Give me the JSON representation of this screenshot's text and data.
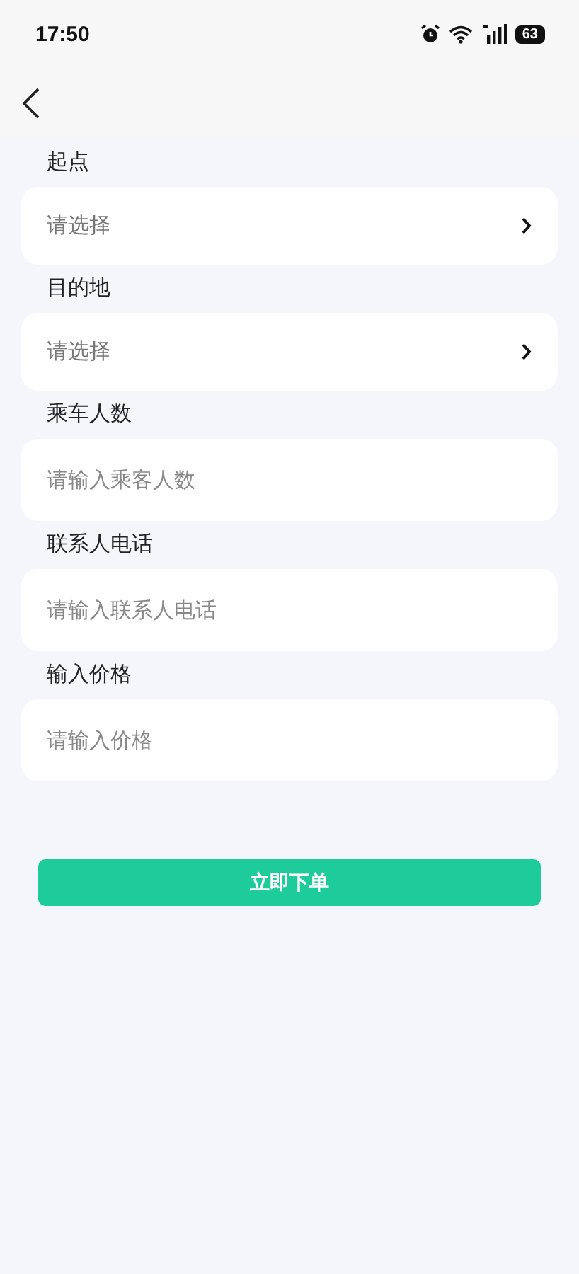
{
  "status_bar": {
    "time": "17:50",
    "battery": "63"
  },
  "fields": [
    {
      "label": "起点",
      "kind": "select",
      "placeholder": "请选择"
    },
    {
      "label": "目的地",
      "kind": "select",
      "placeholder": "请选择"
    },
    {
      "label": "乘车人数",
      "kind": "input",
      "placeholder": "请输入乘客人数"
    },
    {
      "label": "联系人电话",
      "kind": "input",
      "placeholder": "请输入联系人电话"
    },
    {
      "label": "输入价格",
      "kind": "input",
      "placeholder": "请输入价格"
    }
  ],
  "submit_button": "立即下单"
}
